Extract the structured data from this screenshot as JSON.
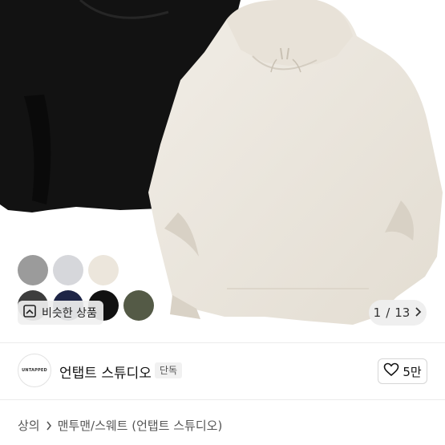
{
  "gallery": {
    "counter_current": "1",
    "counter_separator": "/",
    "counter_total": "13",
    "similar_label": "비슷한 상품",
    "swatch_colors": [
      "#9b9b9b",
      "#d6d7db",
      "#ece6dc",
      "#3d3d3d",
      "#1e2546",
      "#111111",
      "#545a46"
    ]
  },
  "brand": {
    "logo_text": "UNTAPPED",
    "name": "언탭트 스튜디오",
    "badge": "단독",
    "like_count": "5만"
  },
  "breadcrumb": {
    "category": "상의",
    "subcategory": "맨투맨/스웨트 (언탭트 스튜디오)"
  },
  "icons": {
    "similar": "similar-items-icon",
    "counter_next": "chevron-right-icon",
    "like": "heart-outline-icon",
    "breadcrumb_sep": "chevron-right-icon"
  }
}
